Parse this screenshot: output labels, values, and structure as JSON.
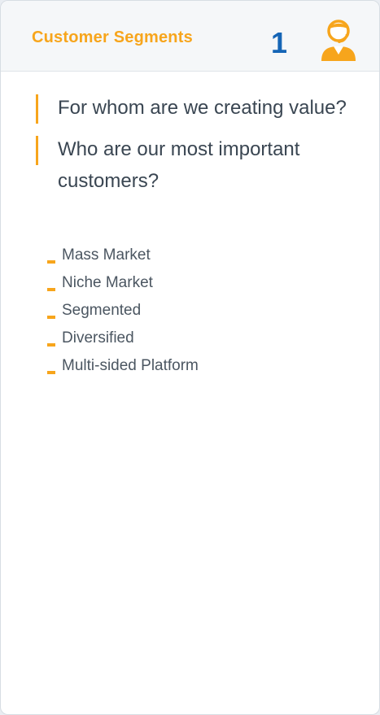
{
  "header": {
    "title": "Customer Segments",
    "number": "1",
    "icon": "customer-avatar-icon",
    "accent_color": "#f7a51c",
    "number_color": "#1565b6"
  },
  "questions": [
    "For whom are we creating value?",
    "Who are our most important customers?"
  ],
  "items": [
    "Mass Market",
    "Niche Market",
    "Segmented",
    "Diversified",
    "Multi-sided Platform"
  ]
}
